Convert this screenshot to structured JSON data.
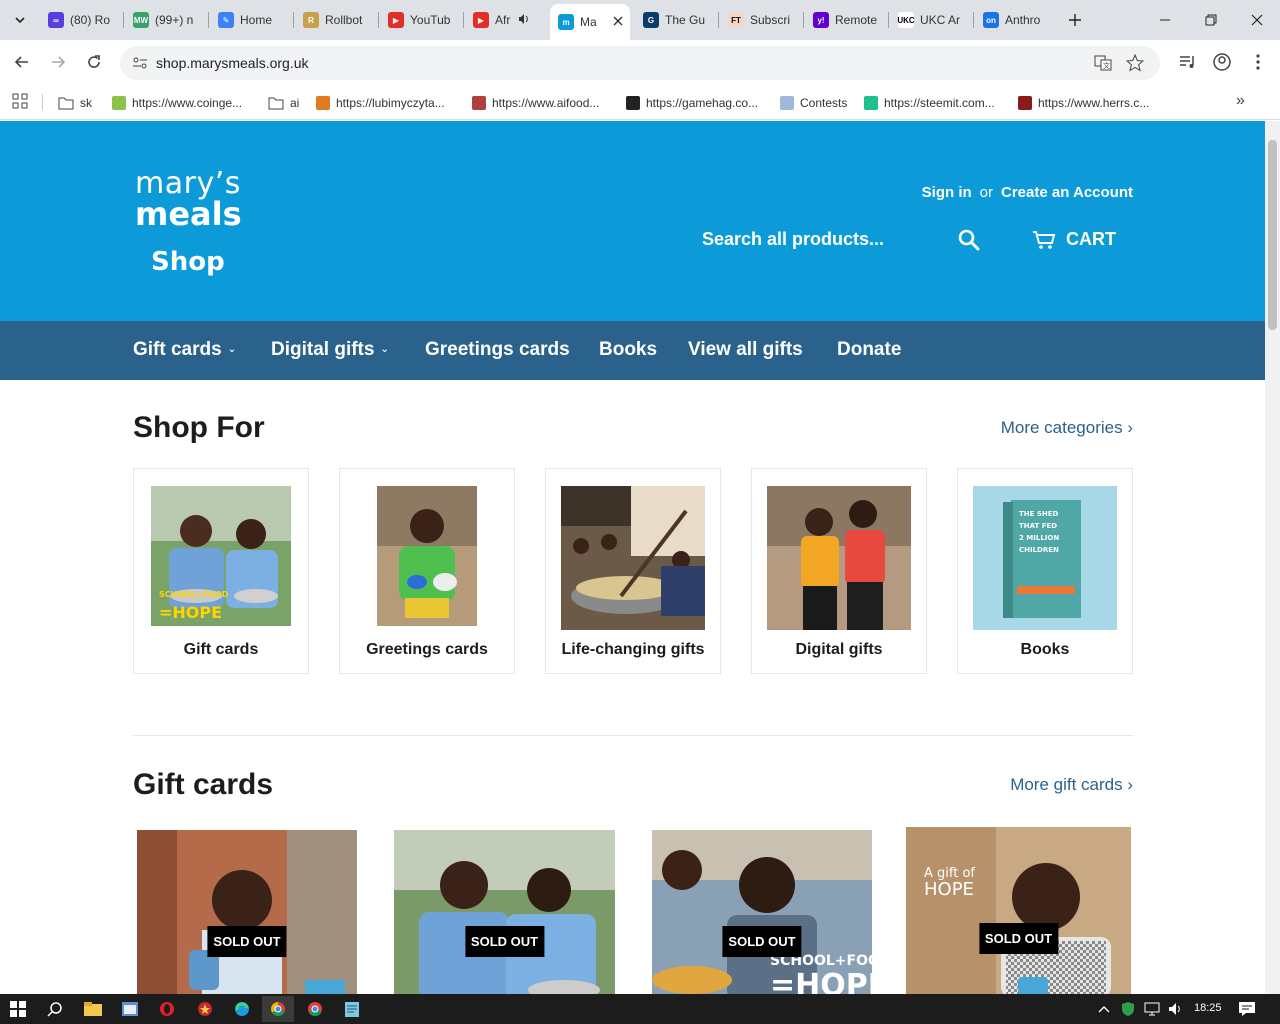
{
  "browser": {
    "tabs": [
      {
        "label": "(80) Ro",
        "color": "#5b3ee0",
        "glyph": "∞"
      },
      {
        "label": "(99+) n",
        "color": "#38a169",
        "glyph": "MW"
      },
      {
        "label": "Home",
        "color": "#3b82f6",
        "glyph": "✎"
      },
      {
        "label": "Rollbot",
        "color": "#c8a24a",
        "glyph": "R"
      },
      {
        "label": "YouTub",
        "color": "#e52d27",
        "glyph": "▶"
      },
      {
        "label": "Afr",
        "color": "#e52d27",
        "glyph": "▶"
      },
      {
        "label": "Ma",
        "color": "#0c9bd8",
        "glyph": "m"
      },
      {
        "label": "The Gu",
        "color": "#0b3b69",
        "glyph": "G"
      },
      {
        "label": "Subscri",
        "color": "#f4d6c5",
        "glyph": "FT"
      },
      {
        "label": "Remote",
        "color": "#6001d2",
        "glyph": "y!"
      },
      {
        "label": "UKC Ar",
        "color": "#ffffff",
        "glyph": "UKC"
      },
      {
        "label": "Anthro",
        "color": "#1a73e8",
        "glyph": "on"
      }
    ],
    "url": "shop.marysmeals.org.uk",
    "bookmarks": [
      {
        "label": "sk",
        "type": "folder"
      },
      {
        "label": "https://www.coinge...",
        "color": "#8bc34a"
      },
      {
        "label": "ai",
        "type": "folder"
      },
      {
        "label": "https://lubimyczyta...",
        "color": "#e07b24"
      },
      {
        "label": "https://www.aifood...",
        "color": "#b04040"
      },
      {
        "label": "https://gamehag.co...",
        "color": "#222222"
      },
      {
        "label": "Contests",
        "color": "#9db8d8"
      },
      {
        "label": "https://steemit.com...",
        "color": "#1fbf8f"
      },
      {
        "label": "https://www.herrs.c...",
        "color": "#8b1a1a"
      }
    ]
  },
  "site": {
    "logo_line1": "mary’s",
    "logo_line2": "meals",
    "logo_line3": "Shop",
    "sign_in": "Sign in",
    "or": "or",
    "create_account": "Create an Account",
    "search_placeholder": "Search all products...",
    "cart_label": "CART",
    "nav": [
      {
        "label": "Gift cards",
        "dropdown": true
      },
      {
        "label": "Digital gifts",
        "dropdown": true
      },
      {
        "label": "Greetings cards",
        "dropdown": false
      },
      {
        "label": "Books",
        "dropdown": false
      },
      {
        "label": "View all gifts",
        "dropdown": false
      },
      {
        "label": "Donate",
        "dropdown": false
      }
    ],
    "shop_for": {
      "title": "Shop For",
      "more": "More categories ›",
      "categories": [
        {
          "label": "Gift cards"
        },
        {
          "label": "Greetings cards"
        },
        {
          "label": "Life-changing gifts"
        },
        {
          "label": "Digital gifts"
        },
        {
          "label": "Books"
        }
      ],
      "book_cover_text": "THE SHED THAT FED 2 MILLION CHILDREN"
    },
    "gift_cards": {
      "title": "Gift cards",
      "more": "More gift cards ›",
      "sold_out": "SOLD OUT",
      "card_overlay_texts": [
        "SCHOOL+FOOD",
        "=HOPE",
        "A gift of",
        "HOPE"
      ]
    },
    "category_overlay": [
      "SCHOOL+FOOD",
      "=HOPE"
    ]
  },
  "taskbar": {
    "time": "18:25"
  },
  "colors": {
    "header_blue": "#0c9bd8",
    "nav_blue": "#2a628c"
  }
}
